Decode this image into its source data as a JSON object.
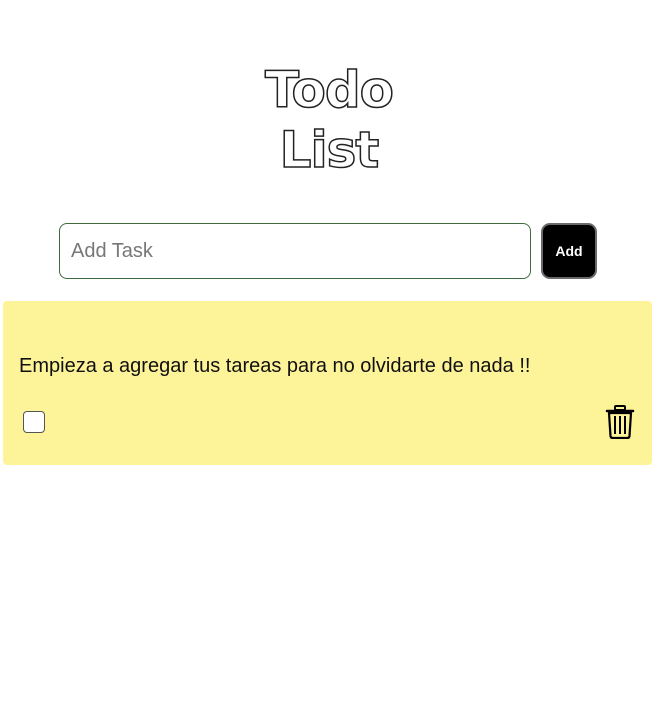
{
  "header": {
    "title_line1": "Todo",
    "title_line2": "List"
  },
  "add_form": {
    "placeholder": "Add Task",
    "value": "",
    "button_label": "Add"
  },
  "tasks": [
    {
      "text": "Empieza a agregar tus tareas para no olvidarte de nada !!",
      "completed": false,
      "delete_icon": "trash-icon"
    }
  ],
  "colors": {
    "card_background": "#fdf399",
    "add_button_background": "#000000",
    "input_border": "#3f6b3f"
  }
}
